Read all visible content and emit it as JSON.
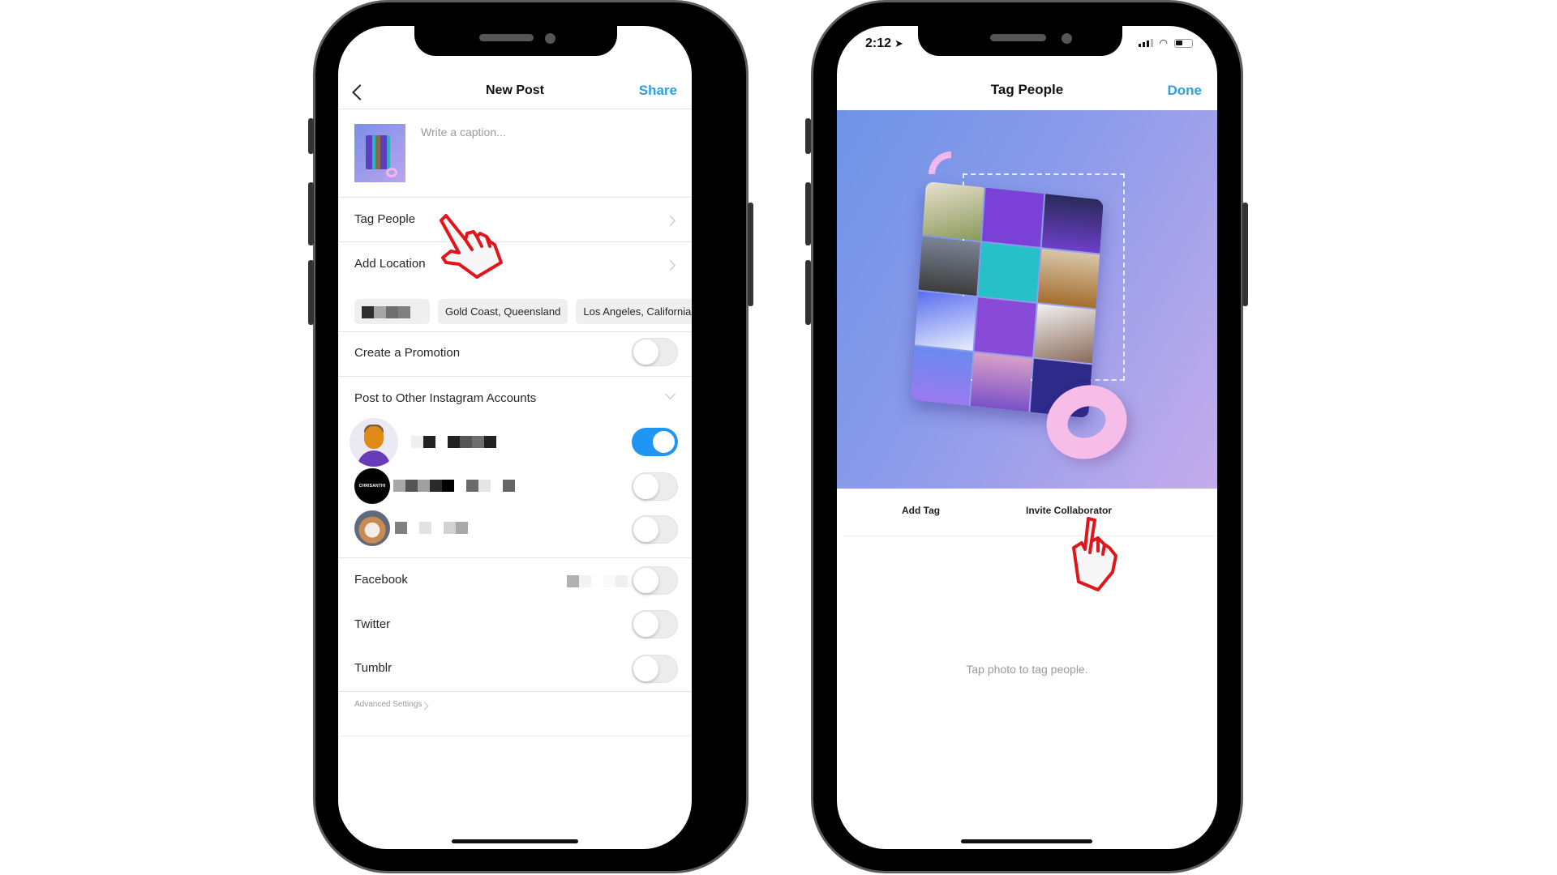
{
  "left_phone": {
    "header": {
      "back_icon": "chevron-left-icon",
      "title": "New Post",
      "action": "Share"
    },
    "caption": {
      "placeholder": "Write a caption..."
    },
    "rows": {
      "tag_people": "Tag People",
      "add_location": "Add Location"
    },
    "location_suggestions": [
      "Gold Coast, Queensland",
      "Los Angeles, California"
    ],
    "create_promotion": {
      "label": "Create a Promotion",
      "enabled": false
    },
    "other_accounts": {
      "label": "Post to Other Instagram Accounts",
      "accounts": [
        {
          "avatar": "person-avatar",
          "name_pixelated": true,
          "enabled": true
        },
        {
          "avatar": "CHRISANTHI",
          "name_pixelated": true,
          "enabled": false
        },
        {
          "avatar": "dog-avatar",
          "name_pixelated": true,
          "enabled": false
        }
      ]
    },
    "share_to": [
      {
        "label": "Facebook",
        "enabled": false
      },
      {
        "label": "Twitter",
        "enabled": false
      },
      {
        "label": "Tumblr",
        "enabled": false
      }
    ],
    "advanced_settings": "Advanced Settings"
  },
  "right_phone": {
    "status_bar": {
      "time": "2:12",
      "location_icon": "location-arrow-icon",
      "signal_icon": "signal-icon",
      "wifi_icon": "wifi-icon",
      "battery_icon": "battery-icon"
    },
    "header": {
      "title": "Tag People",
      "action": "Done"
    },
    "tabs": [
      "Add Tag",
      "Invite Collaborator"
    ],
    "hint": "Tap photo to tag people."
  },
  "annotations": {
    "pointer_icon": "hand-pointer-icon",
    "color": "#e0161b"
  },
  "colors": {
    "accent_blue": "#2d9fe0",
    "toggle_on": "#1f96f2",
    "frame": "#000000"
  }
}
